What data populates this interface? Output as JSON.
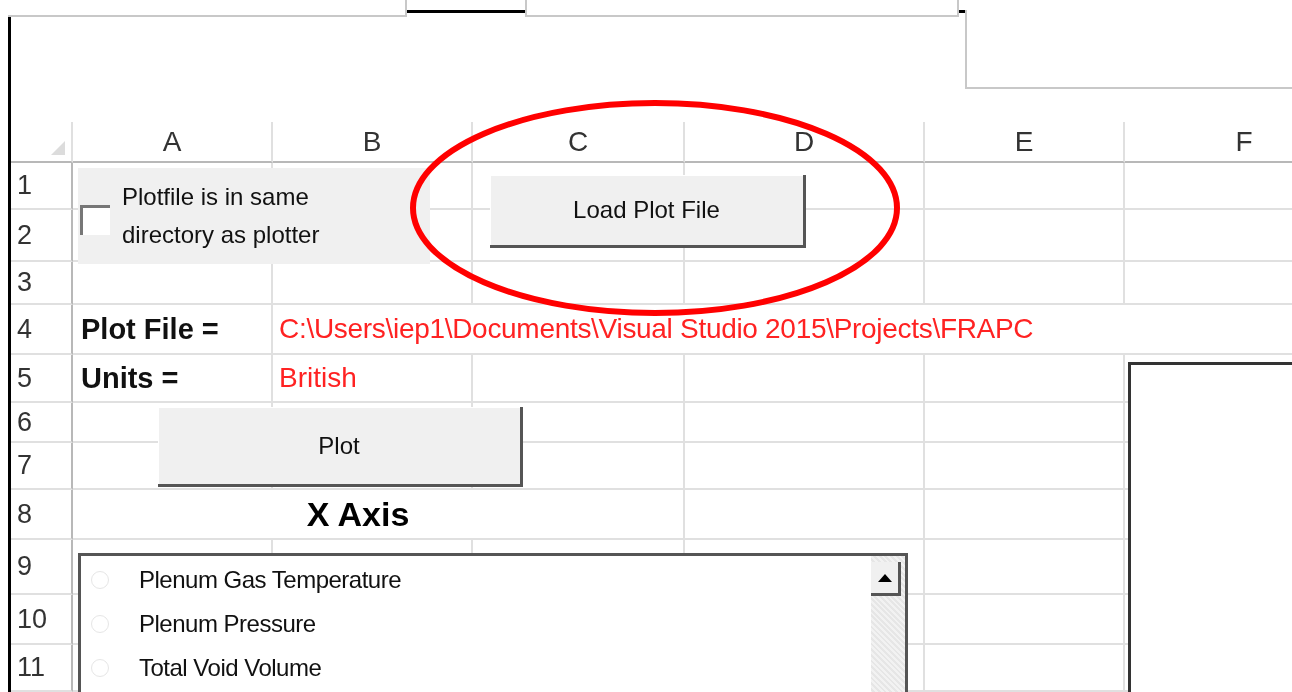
{
  "columns": [
    "A",
    "B",
    "C",
    "D",
    "E",
    "F"
  ],
  "rows": [
    "1",
    "2",
    "3",
    "4",
    "5",
    "6",
    "7",
    "8",
    "9",
    "10",
    "11"
  ],
  "checkbox": {
    "label": "Plotfile is in same directory as plotter",
    "checked": false
  },
  "load_button": "Load Plot File",
  "plot_file": {
    "label": "Plot File =",
    "value": "C:\\Users\\iep1\\Documents\\Visual Studio 2015\\Projects\\FRAPC"
  },
  "units": {
    "label": "Units =",
    "value": "British"
  },
  "plot_button": "Plot",
  "x_axis": {
    "title": "X Axis",
    "options": [
      {
        "label": "Plenum Gas Temperature",
        "selected": false
      },
      {
        "label": "Plenum Pressure",
        "selected": false
      },
      {
        "label": "Total Void Volume",
        "selected": false
      }
    ]
  }
}
